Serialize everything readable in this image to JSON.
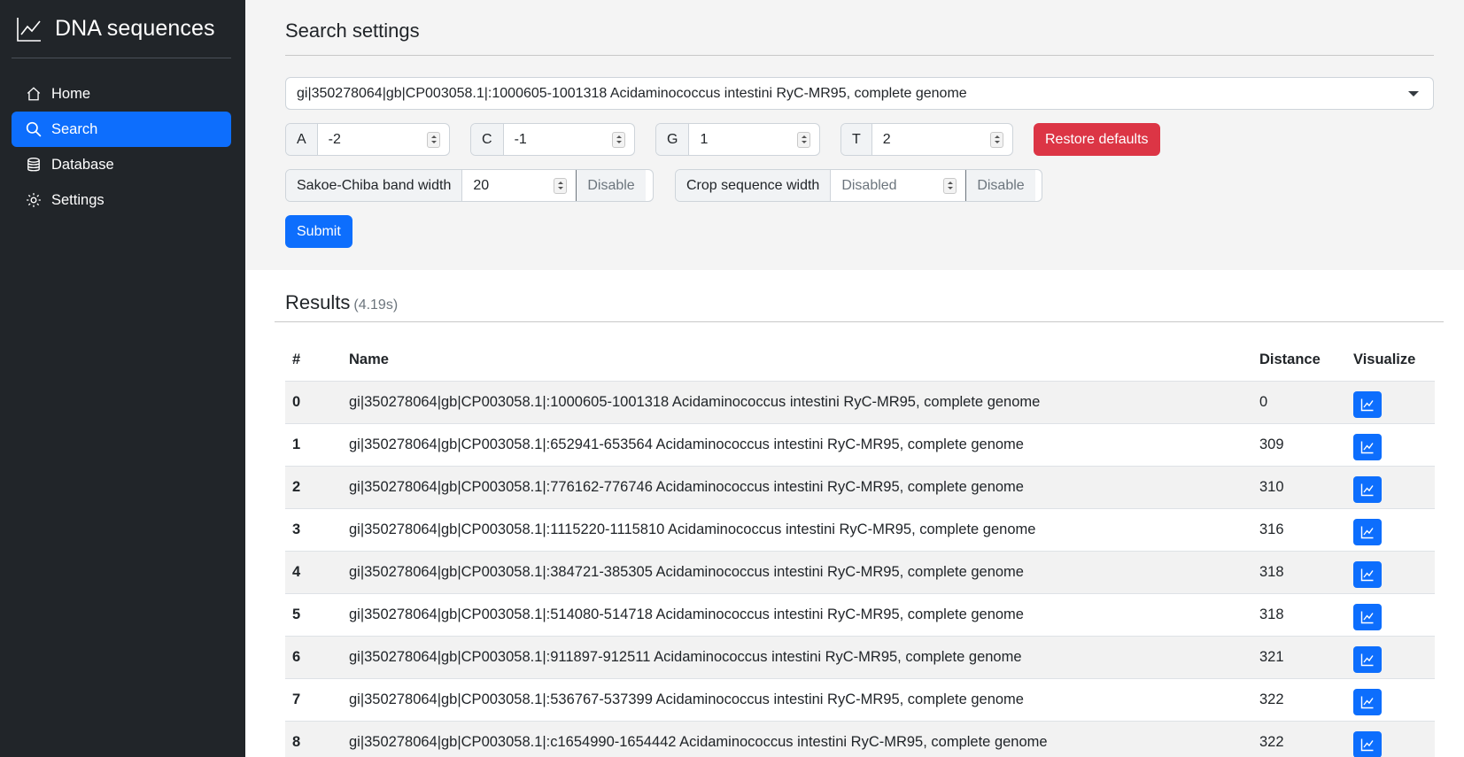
{
  "app": {
    "title": "DNA sequences"
  },
  "sidebar": {
    "items": [
      {
        "label": "Home",
        "icon": "home-icon",
        "active": false
      },
      {
        "label": "Search",
        "icon": "search-icon",
        "active": true
      },
      {
        "label": "Database",
        "icon": "database-icon",
        "active": false
      },
      {
        "label": "Settings",
        "icon": "gear-icon",
        "active": false
      }
    ]
  },
  "settings": {
    "title": "Search settings",
    "sequence_select": "gi|350278064|gb|CP003058.1|:1000605-1001318 Acidaminococcus intestini RyC-MR95, complete genome",
    "weights": [
      {
        "label": "A",
        "value": "-2"
      },
      {
        "label": "C",
        "value": "-1"
      },
      {
        "label": "G",
        "value": "1"
      },
      {
        "label": "T",
        "value": "2"
      }
    ],
    "restore_label": "Restore defaults",
    "band": {
      "label": "Sakoe-Chiba band width",
      "value": "20",
      "button": "Disable"
    },
    "crop": {
      "label": "Crop sequence width",
      "placeholder": "Disabled",
      "button": "Disable"
    },
    "submit_label": "Submit"
  },
  "results": {
    "title": "Results",
    "time": "(4.19s)",
    "headers": {
      "index": "#",
      "name": "Name",
      "distance": "Distance",
      "visualize": "Visualize"
    },
    "rows": [
      {
        "index": "0",
        "name": "gi|350278064|gb|CP003058.1|:1000605-1001318 Acidaminococcus intestini RyC-MR95, complete genome",
        "distance": "0"
      },
      {
        "index": "1",
        "name": "gi|350278064|gb|CP003058.1|:652941-653564 Acidaminococcus intestini RyC-MR95, complete genome",
        "distance": "309"
      },
      {
        "index": "2",
        "name": "gi|350278064|gb|CP003058.1|:776162-776746 Acidaminococcus intestini RyC-MR95, complete genome",
        "distance": "310"
      },
      {
        "index": "3",
        "name": "gi|350278064|gb|CP003058.1|:1115220-1115810 Acidaminococcus intestini RyC-MR95, complete genome",
        "distance": "316"
      },
      {
        "index": "4",
        "name": "gi|350278064|gb|CP003058.1|:384721-385305 Acidaminococcus intestini RyC-MR95, complete genome",
        "distance": "318"
      },
      {
        "index": "5",
        "name": "gi|350278064|gb|CP003058.1|:514080-514718 Acidaminococcus intestini RyC-MR95, complete genome",
        "distance": "318"
      },
      {
        "index": "6",
        "name": "gi|350278064|gb|CP003058.1|:911897-912511 Acidaminococcus intestini RyC-MR95, complete genome",
        "distance": "321"
      },
      {
        "index": "7",
        "name": "gi|350278064|gb|CP003058.1|:536767-537399 Acidaminococcus intestini RyC-MR95, complete genome",
        "distance": "322"
      },
      {
        "index": "8",
        "name": "gi|350278064|gb|CP003058.1|:c1654990-1654442 Acidaminococcus intestini RyC-MR95, complete genome",
        "distance": "322"
      }
    ]
  },
  "colors": {
    "sidebar_bg": "#212529",
    "primary": "#0d6efd",
    "danger": "#dc3545"
  }
}
